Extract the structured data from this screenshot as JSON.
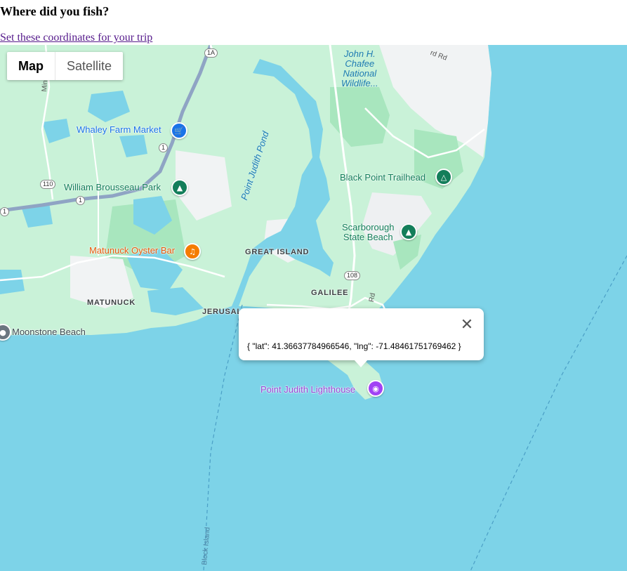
{
  "page": {
    "title": "Where did you fish?",
    "link_text": "Set these coordinates for your trip"
  },
  "map_type": {
    "map_label": "Map",
    "satellite_label": "Satellite",
    "selected": "Map"
  },
  "places": {
    "whaley": "Whaley Farm Market",
    "brousseau": "William Brousseau Park",
    "matunuck_oyster": "Matunuck Oyster Bar",
    "moonstone": "Moonstone Beach",
    "black_point": "Black Point Trailhead",
    "scarborough_1": "Scarborough",
    "scarborough_2": "State Beach",
    "lighthouse": "Point Judith Lighthouse",
    "refuge_1": "John H.",
    "refuge_2": "Chafee",
    "refuge_3": "National",
    "refuge_4": "Wildlife...",
    "pond": "Point Judith Pond",
    "great_island": "GREAT ISLAND",
    "galilee": "GALILEE",
    "matunuck": "MATUNUCK",
    "jerusalem": "JERUSAL",
    "road_rd_1": "Rd",
    "road_rd_2": "rd Rd",
    "road_mi": "Min",
    "ferry": "Block Island"
  },
  "shields": {
    "r1a": "1A",
    "r1_top": "1",
    "r110": "110",
    "r1_mid": "1",
    "r1_left": "1",
    "r108": "108"
  },
  "info_window": {
    "content": "{ \"lat\": 41.36637784966546, \"lng\": -71.48461751769462 }",
    "close_symbol": "✕"
  },
  "colors": {
    "water": "#7dd3e8",
    "land": "#c9f2d8",
    "park": "#a8e6be",
    "urban": "#f1f3f4",
    "road_major": "#8fa4c4",
    "poi_teal": "#137e5a",
    "poi_blue": "#1a73e8",
    "poi_orange": "#e8590c",
    "poi_purple": "#9c45d6"
  },
  "icons": {
    "whaley": "shopping-cart-icon",
    "brousseau": "tree-icon",
    "oyster": "restaurant-icon",
    "moonstone": "beach-icon",
    "black_point": "hiking-icon",
    "scarborough": "beach-umbrella-icon",
    "lighthouse": "camera-icon",
    "close": "close-icon"
  }
}
